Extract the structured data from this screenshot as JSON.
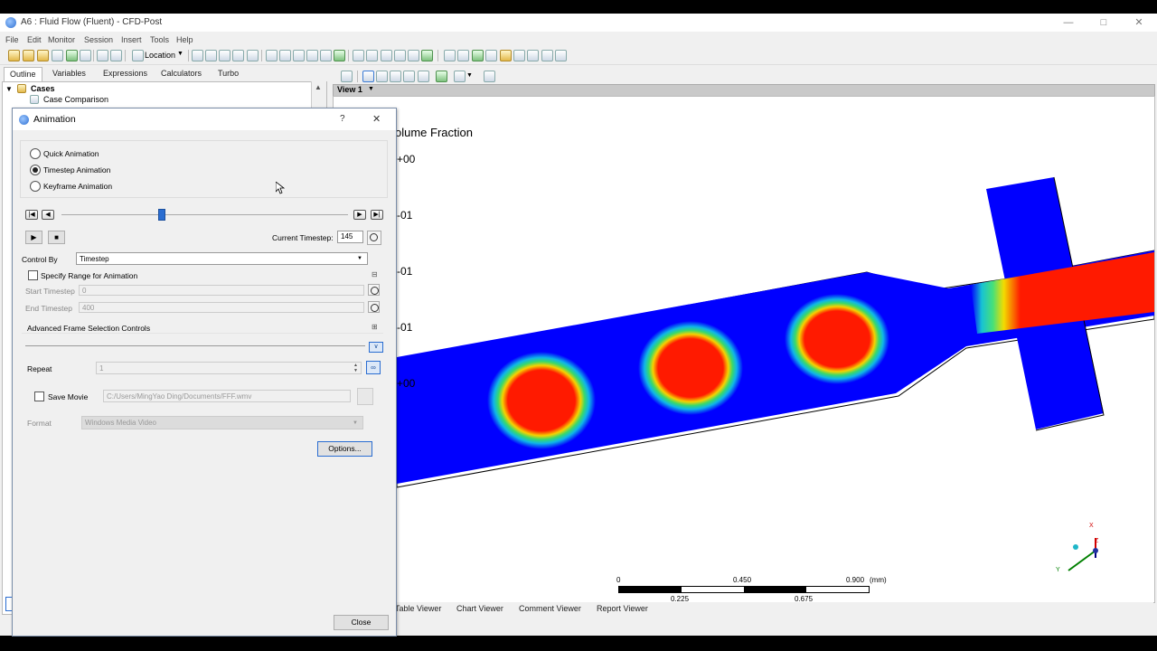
{
  "window": {
    "title": "A6 : Fluid Flow (Fluent) - CFD-Post"
  },
  "menu": [
    "File",
    "Edit",
    "Monitor",
    "Session",
    "Insert",
    "Tools",
    "Help"
  ],
  "toolbar": {
    "location_label": "Location"
  },
  "left_tabs": [
    "Outline",
    "Variables",
    "Expressions",
    "Calculators",
    "Turbo"
  ],
  "tree": {
    "root": "Cases",
    "child": "Case Comparison"
  },
  "viewer": {
    "view_label": "View 1",
    "legend_title": "olume Fraction",
    "legend_ticks": [
      "+00",
      "-01",
      "-01",
      "-01",
      "+00"
    ],
    "scale": {
      "top_labels": [
        "0",
        "0.450",
        "0.900"
      ],
      "unit": "(mm)",
      "bottom_labels": [
        "0.225",
        "0.675"
      ]
    },
    "axis": {
      "x": "X",
      "y": "Y",
      "z": "Z"
    },
    "tabs": [
      "Table Viewer",
      "Chart Viewer",
      "Comment Viewer",
      "Report Viewer"
    ]
  },
  "dialog": {
    "title": "Animation",
    "help": "?",
    "close_x": "✕",
    "modes": [
      "Quick Animation",
      "Timestep Animation",
      "Keyframe Animation"
    ],
    "selected_mode": "Timestep Animation",
    "timeline_fraction": 0.35,
    "current_timestep_label": "Current Timestep:",
    "current_timestep": "145",
    "control_by_label": "Control By",
    "control_by_value": "Timestep",
    "specify_range_label": "Specify Range for Animation",
    "start_label": "Start Timestep",
    "start_value": "0",
    "end_label": "End Timestep",
    "end_value": "400",
    "advanced_label": "Advanced Frame Selection Controls",
    "repeat_label": "Repeat",
    "repeat_value": "1",
    "save_movie_label": "Save Movie",
    "movie_path": "C:/Users/MingYao Ding/Documents/FFF.wmv",
    "format_label": "Format",
    "format_value": "Windows Media Video",
    "options_label": "Options...",
    "close_label": "Close"
  }
}
